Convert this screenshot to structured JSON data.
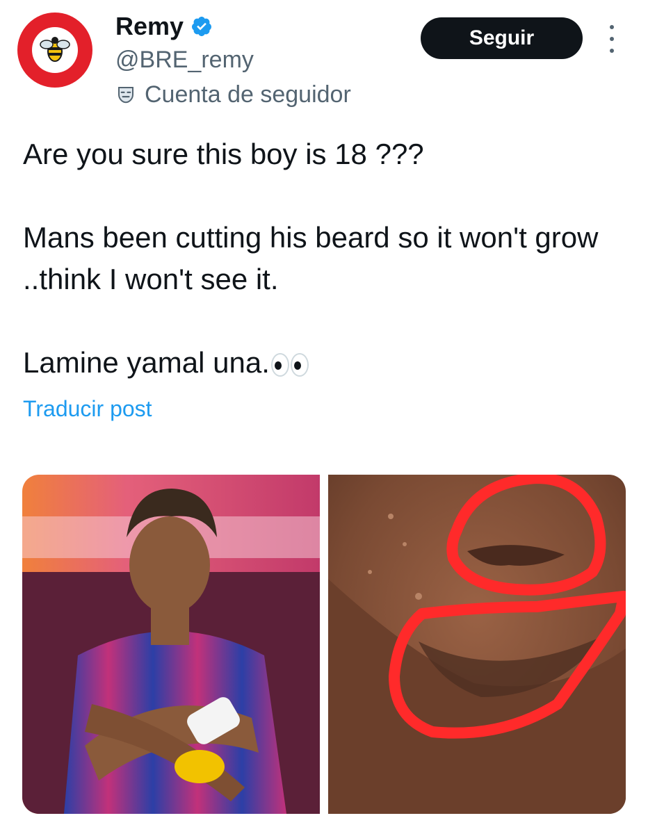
{
  "author": {
    "name": "Remy",
    "handle": "@BRE_remy",
    "account_label": "Cuenta de seguidor",
    "verified": true,
    "avatar_icon": "brentford-fc-crest-icon"
  },
  "actions": {
    "follow_label": "Seguir",
    "more_icon": "more-vertical-icon"
  },
  "post": {
    "line1": "Are you sure this boy is 18 ???",
    "line2": "Mans been cutting his beard so it won't grow ..think I won't see it.",
    "line3": "Lamine yamal una.",
    "emoji": "eyes-emoji-icon",
    "translate_label": "Traducir post"
  },
  "media": {
    "images": [
      {
        "icon": "photo-player-crossed-arms"
      },
      {
        "icon": "photo-chin-closeup-circled"
      }
    ]
  },
  "colors": {
    "link": "#1d9bf0",
    "follow_bg": "#0f1419",
    "secondary_text": "#536471",
    "verified": "#1d9bf0",
    "annotation_red": "#ff2a2a",
    "avatar_red": "#e3202a"
  }
}
